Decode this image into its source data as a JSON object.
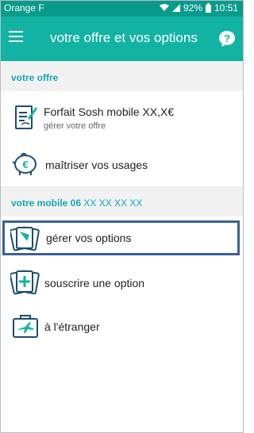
{
  "statusbar": {
    "carrier": "Orange F",
    "battery": "92%",
    "time": "10:51"
  },
  "appbar": {
    "title": "votre offre et vos options"
  },
  "sections": {
    "offer": {
      "title": "votre offre"
    },
    "mobile": {
      "title_prefix": "votre mobile 06",
      "number": "XX XX XX XX"
    }
  },
  "items": {
    "forfait": {
      "label": "Forfait Sosh mobile XX,X€",
      "sub": "gérer votre offre"
    },
    "usages": {
      "label": "maîtriser vos usages"
    },
    "options": {
      "label": "gérer vos options"
    },
    "souscrire": {
      "label": "souscrire une option"
    },
    "etranger": {
      "label": "à l'étranger"
    }
  },
  "colors": {
    "statusbar": "#0a9a8c",
    "appbar": "#12b3a2",
    "accent": "#12a6b4",
    "highlight": "#3c5f9a"
  }
}
